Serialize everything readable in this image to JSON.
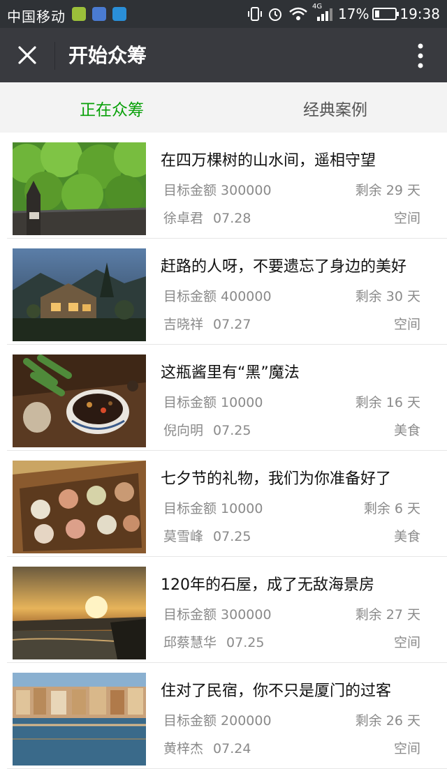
{
  "status_bar": {
    "carrier": "中国移动",
    "network": "4G",
    "battery": "17%",
    "time": "19:38"
  },
  "header": {
    "title": "开始众筹",
    "close_icon": "close-icon",
    "more_icon": "more-vertical-icon"
  },
  "tabs": [
    {
      "label": "正在众筹",
      "active": true
    },
    {
      "label": "经典案例",
      "active": false
    }
  ],
  "projects": [
    {
      "title": "在四万棵树的山水间，遥相守望",
      "target": "目标金额 300000",
      "remaining": "剩余 29 天",
      "author": "徐卓君",
      "date": "07.28",
      "category": "空间",
      "image": "bamboo-forest-photo"
    },
    {
      "title": "赶路的人呀，不要遗忘了身边的美好",
      "target": "目标金额 400000",
      "remaining": "剩余 30 天",
      "author": "吉晓祥",
      "date": "07.27",
      "category": "空间",
      "image": "mountain-house-photo"
    },
    {
      "title": "这瓶酱里有“黑”魔法",
      "target": "目标金额 10000",
      "remaining": "剩余 16 天",
      "author": "倪向明",
      "date": "07.25",
      "category": "美食",
      "image": "sauce-bowl-photo"
    },
    {
      "title": "七夕节的礼物，我们为你准备好了",
      "target": "目标金额 10000",
      "remaining": "剩余 6 天",
      "author": "莫雪峰",
      "date": "07.25",
      "category": "美食",
      "image": "chocolate-box-photo"
    },
    {
      "title": "120年的石屋，成了无敌海景房",
      "target": "目标金额 300000",
      "remaining": "剩余 27 天",
      "author": "邱蔡慧华",
      "date": "07.25",
      "category": "空间",
      "image": "sunset-sea-photo"
    },
    {
      "title": "住对了民宿，你不只是厦门的过客",
      "target": "目标金额 200000",
      "remaining": "剩余 26 天",
      "author": "黄梓杰",
      "date": "07.24",
      "category": "空间",
      "image": "waterfront-town-photo"
    }
  ]
}
